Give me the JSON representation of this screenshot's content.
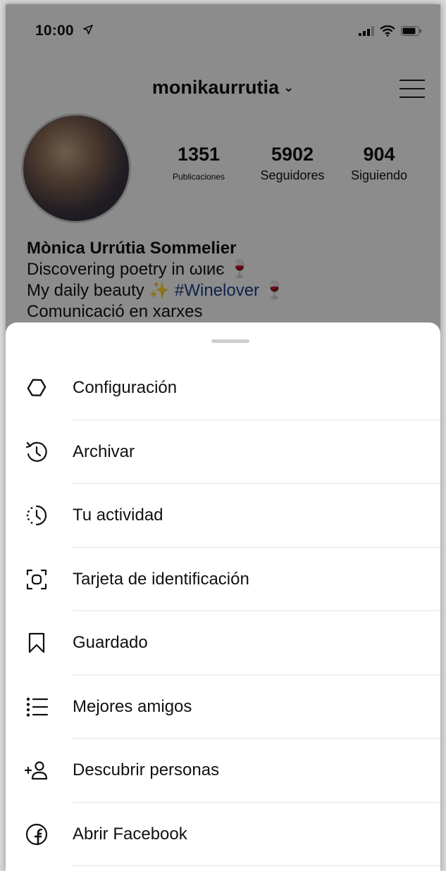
{
  "status_bar": {
    "time": "10:00"
  },
  "profile": {
    "username": "monikaurrutia",
    "stats": [
      {
        "value": "1351",
        "label": "Publicaciones"
      },
      {
        "value": "5902",
        "label": "Seguidores"
      },
      {
        "value": "904",
        "label": "Siguiendo"
      }
    ],
    "bio": {
      "name": "Mònica Urrútia Sommelier",
      "line1": "Discovering poetry in ωιиє",
      "line1_emoji": "🍷",
      "line2_text": "My daily beauty",
      "line2_emoji1": "✨",
      "line2_tag": "#Winelover",
      "line2_emoji2": "🍷",
      "line3": "Comunicació en xarxes"
    }
  },
  "menu": {
    "items": [
      {
        "icon": "settings-icon",
        "label": "Configuración"
      },
      {
        "icon": "archive-icon",
        "label": "Archivar"
      },
      {
        "icon": "activity-icon",
        "label": "Tu actividad"
      },
      {
        "icon": "nametag-icon",
        "label": "Tarjeta de identificación"
      },
      {
        "icon": "bookmark-icon",
        "label": "Guardado"
      },
      {
        "icon": "close-friends-icon",
        "label": "Mejores amigos"
      },
      {
        "icon": "add-person-icon",
        "label": "Descubrir personas"
      },
      {
        "icon": "facebook-icon",
        "label": "Abrir Facebook"
      }
    ]
  },
  "colors": {
    "hashtag": "#1a3e8c",
    "overlay": "rgba(0,0,0,0.45)"
  }
}
